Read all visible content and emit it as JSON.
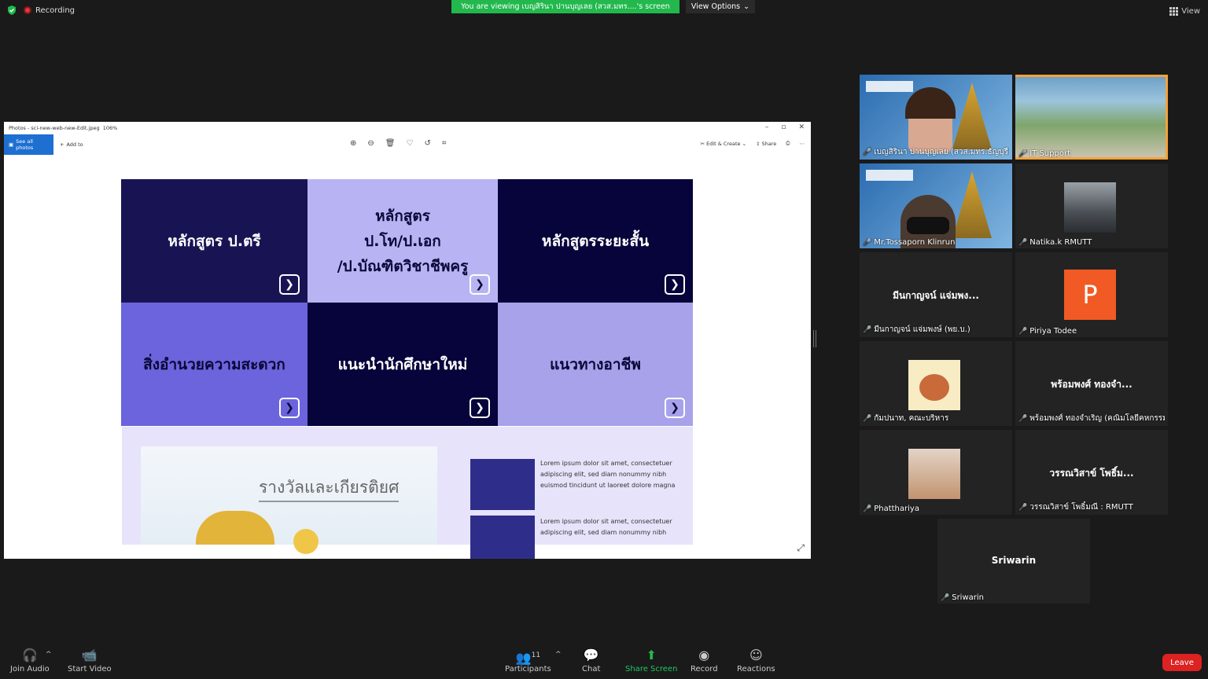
{
  "topbar": {
    "recording": "Recording",
    "viewing_banner": "You are viewing เบญสิรินา ปานบุญเลย (สวส.มทร....'s screen",
    "view_options": "View Options",
    "view": "View"
  },
  "window": {
    "title": "Photos - sci-new-web-new-Edit.jpeg",
    "zoom": "106%",
    "see_all": "See all photos",
    "add_to": "Add to",
    "edit_create": "Edit & Create",
    "share": "Share"
  },
  "tiles": [
    {
      "label": "หลักสูตร ป.ตรี",
      "color": "#181454"
    },
    {
      "label": "หลักสูตร\nป.โท/ป.เอก\n/ป.บัณฑิตวิชาชีพครู",
      "color": "#b8b4f4"
    },
    {
      "label": "หลักสูตรระยะสั้น",
      "color": "#06043a"
    },
    {
      "label": "สิ่งอำนวยความสะดวก",
      "color": "#6c64dc"
    },
    {
      "label": "แนะนำนักศึกษาใหม่",
      "color": "#06043a"
    },
    {
      "label": "แนวทางอาชีพ",
      "color": "#a8a2ea"
    }
  ],
  "lower": {
    "award_title": "รางวัลและเกียรติยศ",
    "lorem1": "Lorem ipsum dolor sit amet, consectetuer adipiscing elit, sed diam nonummy nibh euismod tincidunt ut laoreet dolore magna",
    "lorem2": "Lorem ipsum dolor sit amet, consectetuer adipiscing elit, sed diam nonummy nibh"
  },
  "participants": [
    {
      "name": "เบญสิรินา ปานบุญเลย (สวส.มทร.ธัญบุรี)",
      "type": "video"
    },
    {
      "name": "IT Support",
      "type": "video2"
    },
    {
      "name": "Mr.Tossaporn Klinrun",
      "type": "video3"
    },
    {
      "name": "Natika.k RMUTT",
      "type": "photo"
    },
    {
      "name": "มีนกาญจน์ แจ่มพงษ์ (พย.บ.)",
      "big": "มีนกาญจน์ แจ่มพง...",
      "type": "text"
    },
    {
      "name": "Piriya Todee",
      "badge": "P",
      "type": "badge"
    },
    {
      "name": "กัมปนาท, คณะบริหาร",
      "type": "cartoon"
    },
    {
      "name": "พร้อมพงศ์ ทองจำเริญ (คณิมโลยีคหกรรม...",
      "big": "พร้อมพงศ์ ทองจำ...",
      "type": "text"
    },
    {
      "name": "Phatthariya",
      "type": "photo2"
    },
    {
      "name": "วรรณวิสาข์ โพธิ์มณี : RMUTT",
      "big": "วรรณวิสาข์ โพธิ์ม...",
      "type": "text"
    },
    {
      "name": "Sriwarin",
      "big": "Sriwarin",
      "type": "text"
    }
  ],
  "bottombar": {
    "join_audio": "Join Audio",
    "start_video": "Start Video",
    "participants": "Participants",
    "participants_count": "11",
    "chat": "Chat",
    "share_screen": "Share Screen",
    "record": "Record",
    "reactions": "Reactions",
    "leave": "Leave"
  },
  "colors": {
    "active_speaker": "#c6e26a",
    "share_green": "#22b84d",
    "leave": "#dd2222"
  }
}
